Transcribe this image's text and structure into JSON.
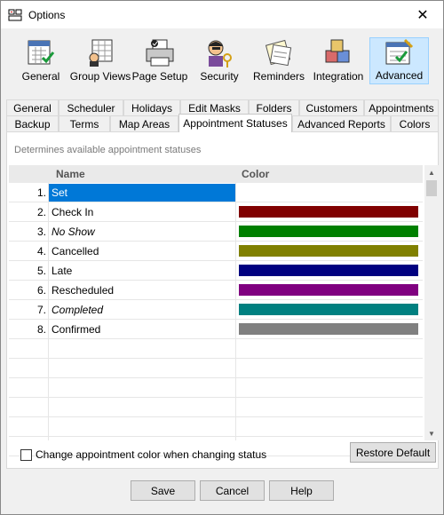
{
  "window": {
    "title": "Options"
  },
  "toolbar": {
    "items": [
      {
        "label": "General",
        "icon": "general-icon"
      },
      {
        "label": "Group Views",
        "icon": "group-views-icon"
      },
      {
        "label": "Page Setup",
        "icon": "printer-icon"
      },
      {
        "label": "Security",
        "icon": "security-icon"
      },
      {
        "label": "Reminders",
        "icon": "reminders-icon"
      },
      {
        "label": "Integration",
        "icon": "integration-icon"
      },
      {
        "label": "Advanced",
        "icon": "advanced-icon",
        "active": true
      }
    ]
  },
  "tabs": {
    "row1": [
      "General",
      "Scheduler",
      "Holidays",
      "Edit Masks",
      "Folders",
      "Customers",
      "Appointments"
    ],
    "row2": [
      "Backup",
      "Terms",
      "Map Areas",
      "Appointment Statuses",
      "Advanced Reports",
      "Colors"
    ],
    "active": "Appointment Statuses"
  },
  "panel": {
    "description": "Determines available appointment statuses",
    "columns": {
      "name": "Name",
      "color": "Color"
    },
    "rows": [
      {
        "num": "1.",
        "name": "Set",
        "color": "#ffffff",
        "selected": true,
        "italic": false
      },
      {
        "num": "2.",
        "name": "Check In",
        "color": "#800000",
        "italic": false
      },
      {
        "num": "3.",
        "name": "No Show",
        "color": "#008000",
        "italic": true
      },
      {
        "num": "4.",
        "name": "Cancelled",
        "color": "#808000",
        "italic": false
      },
      {
        "num": "5.",
        "name": "Late",
        "color": "#000080",
        "italic": false
      },
      {
        "num": "6.",
        "name": "Rescheduled",
        "color": "#800080",
        "italic": false
      },
      {
        "num": "7.",
        "name": "Completed",
        "color": "#008080",
        "italic": true
      },
      {
        "num": "8.",
        "name": "Confirmed",
        "color": "#808080",
        "italic": false
      }
    ],
    "checkbox_label": "Change appointment color when changing status",
    "checkbox_checked": false,
    "restore_label": "Restore Default"
  },
  "footer": {
    "save": "Save",
    "cancel": "Cancel",
    "help": "Help"
  },
  "colors": {
    "selection": "#0078d7",
    "active_tool": "#cce8ff"
  }
}
